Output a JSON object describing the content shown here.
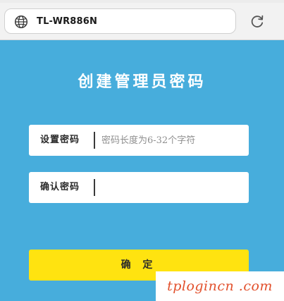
{
  "browser": {
    "address": "TL-WR886N",
    "globe_icon": "globe-icon",
    "reload_icon": "reload-icon"
  },
  "page": {
    "title": "创建管理员密码"
  },
  "form": {
    "password": {
      "label": "设置密码",
      "value": "",
      "placeholder": "密码长度为6-32个字符"
    },
    "confirm": {
      "label": "确认密码",
      "value": "",
      "placeholder": ""
    }
  },
  "actions": {
    "confirm_label": "确 定"
  },
  "watermark": {
    "text": "tplogincn .com"
  },
  "colors": {
    "page_background": "#47addc",
    "button_background": "#ffe310",
    "watermark_text": "#e2502c",
    "chrome_background": "#f2f2f2"
  }
}
